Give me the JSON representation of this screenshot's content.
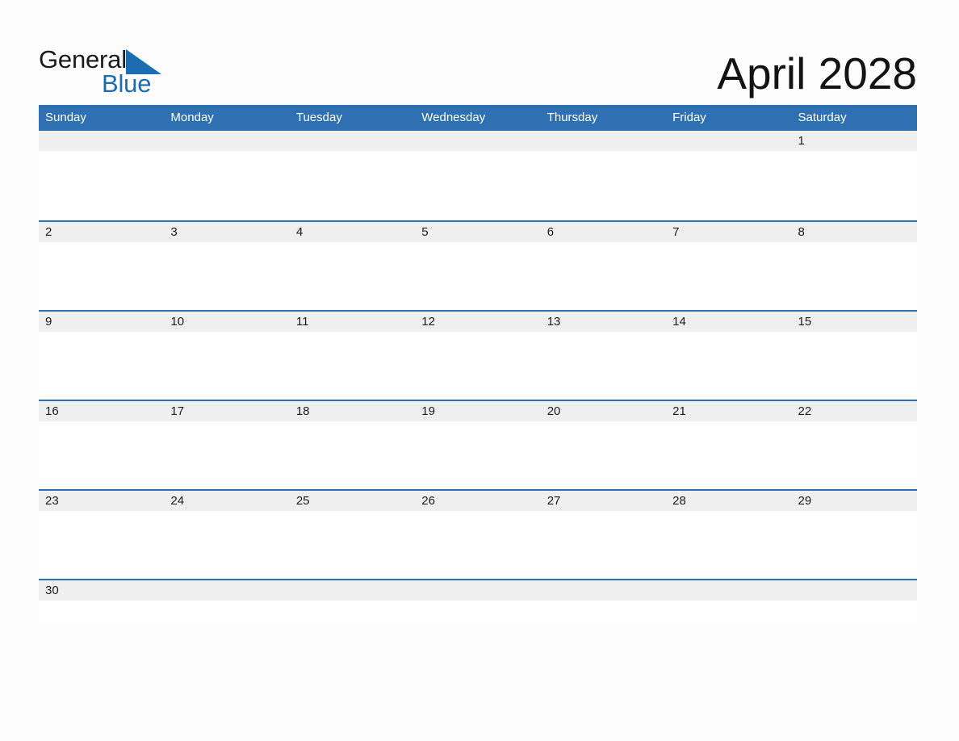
{
  "brand": {
    "name_line1": "General",
    "name_line2": "Blue",
    "triangle_color": "#1b6cb0",
    "text_color_line1": "#1a1a1a",
    "text_color_line2": "#1b6cb0"
  },
  "header": {
    "month_title": "April 2028",
    "accent_color": "#2e70b2",
    "band_color": "#efefef"
  },
  "calendar": {
    "weekdays": [
      "Sunday",
      "Monday",
      "Tuesday",
      "Wednesday",
      "Thursday",
      "Friday",
      "Saturday"
    ],
    "weeks": [
      [
        "",
        "",
        "",
        "",
        "",
        "",
        "1"
      ],
      [
        "2",
        "3",
        "4",
        "5",
        "6",
        "7",
        "8"
      ],
      [
        "9",
        "10",
        "11",
        "12",
        "13",
        "14",
        "15"
      ],
      [
        "16",
        "17",
        "18",
        "19",
        "20",
        "21",
        "22"
      ],
      [
        "23",
        "24",
        "25",
        "26",
        "27",
        "28",
        "29"
      ],
      [
        "30",
        "",
        "",
        "",
        "",
        "",
        ""
      ]
    ]
  }
}
